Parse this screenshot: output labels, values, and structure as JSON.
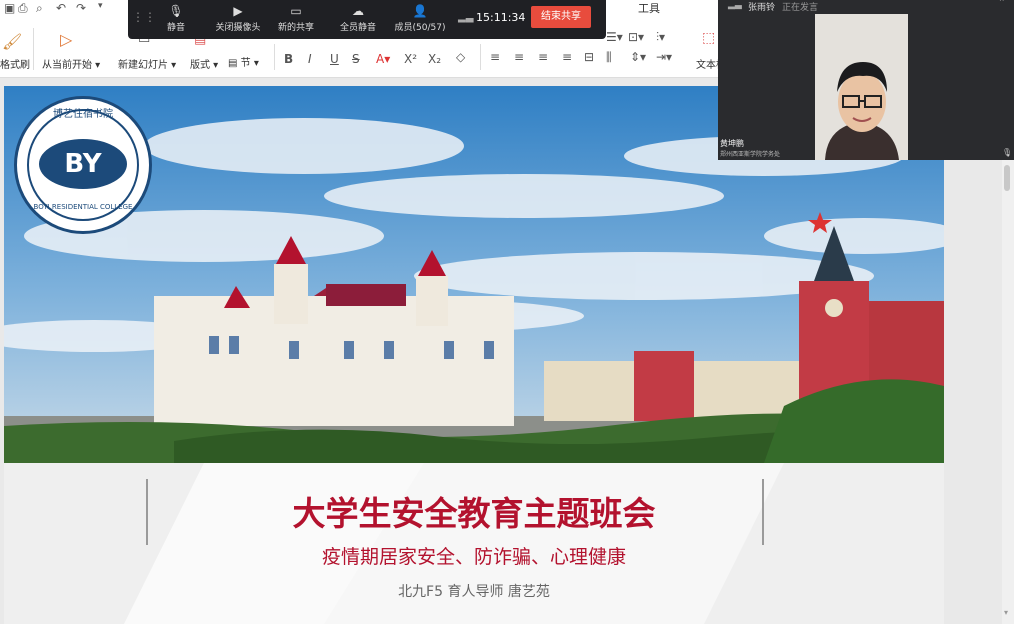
{
  "ribbon": {
    "tab_tools": "工具",
    "format_painter": "格式刷",
    "from_current": "从当前开始",
    "new_slide": "新建幻灯片",
    "layout": "版式",
    "section": "节",
    "text_box": "文本框"
  },
  "meeting_bar": {
    "mute": "静音",
    "camera_off": "关闭摄像头",
    "new_share": "新的共享",
    "mute_all": "全员静音",
    "members": "成员(50/57)",
    "time": "15:11:34",
    "end_share": "结束共享"
  },
  "video": {
    "speaker_name": "张雨铃",
    "speaker_status": "正在发言",
    "participant_name": "黄坤鹏",
    "participant_org": "郑州西亚斯学院学务处"
  },
  "slide": {
    "logo_text": "BY",
    "logo_cn": "博艺住宿书院",
    "logo_en": "BOYI RESIDENTIAL COLLEGE",
    "title": "大学生安全教育主题班会",
    "subtitle": "疫情期居家安全、防诈骗、心理健康",
    "presenter": "北九F5  育人导师  唐艺苑"
  },
  "colors": {
    "accent_red": "#b3122e",
    "end_button": "#e84c3d",
    "meeting_bg": "#1f2024"
  }
}
